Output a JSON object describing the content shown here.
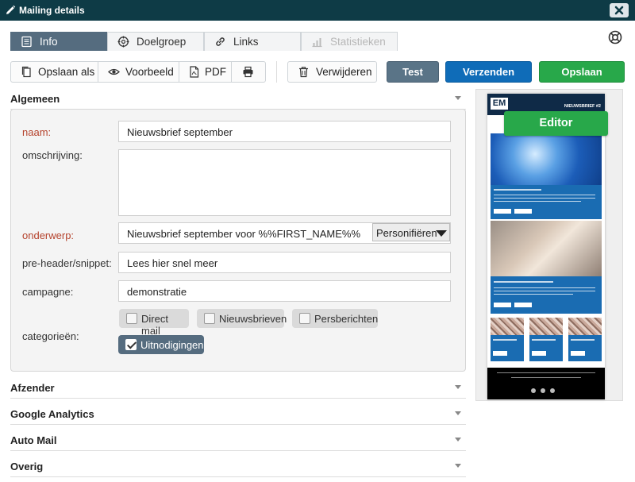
{
  "window": {
    "title": "Mailing details"
  },
  "tabs": [
    {
      "label": "Info",
      "state": "active"
    },
    {
      "label": "Doelgroep",
      "state": "normal"
    },
    {
      "label": "Links",
      "state": "normal"
    },
    {
      "label": "Statistieken",
      "state": "disabled"
    }
  ],
  "toolbar": {
    "save_as": "Opslaan als",
    "preview": "Voorbeeld",
    "pdf": "PDF",
    "delete": "Verwijderen",
    "test": "Test",
    "send": "Verzenden",
    "save": "Opslaan"
  },
  "sections": {
    "general": "Algemeen",
    "sender": "Afzender",
    "analytics": "Google Analytics",
    "automail": "Auto Mail",
    "other": "Overig"
  },
  "form": {
    "name_label": "naam:",
    "name_value": "Nieuwsbrief september",
    "description_label": "omschrijving:",
    "subject_label": "onderwerp:",
    "subject_value": "Nieuwsbrief september voor %%FIRST_NAME%%",
    "personalize": "Personifiëren",
    "preheader_label": "pre-header/snippet:",
    "preheader_value": "Lees hier snel meer",
    "campaign_label": "campagne:",
    "campaign_value": "demonstratie",
    "categories_label": "categorieën:",
    "categories": [
      {
        "label": "Direct mail",
        "checked": false
      },
      {
        "label": "Nieuwsbrieven",
        "checked": false
      },
      {
        "label": "Persberichten",
        "checked": false
      },
      {
        "label": "Uitnodigingen",
        "checked": true
      }
    ]
  },
  "preview": {
    "logo": "EM",
    "newsletter_title": "NIEUWSBRIEF #2",
    "editor_button": "Editor"
  },
  "colors": {
    "titlebar": "#0e3b46",
    "tab_active": "#556c7f",
    "send": "#0f6cb8",
    "save": "#28a84a",
    "required_label": "#b5432d"
  }
}
